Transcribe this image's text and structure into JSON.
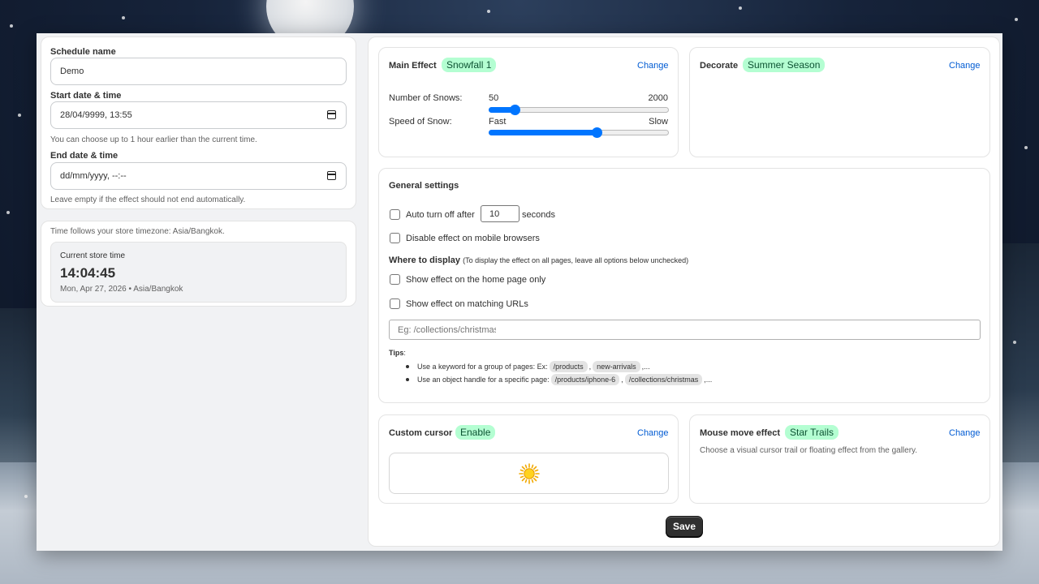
{
  "schedule": {
    "name_label": "Schedule name",
    "name_value": "Demo",
    "start_label": "Start date & time",
    "start_value": "28/04/9999, 13:55",
    "start_help": "You can choose up to 1 hour earlier than the current time.",
    "end_label": "End date & time",
    "end_placeholder": "dd/mm/yyyy, --:--",
    "end_help": "Leave empty if the effect should not end automatically."
  },
  "timezone": {
    "note": "Time follows your store timezone: Asia/Bangkok.",
    "current_label": "Current store time",
    "time": "14:04:45",
    "date_line": "Mon, Apr 27, 2026 • Asia/Bangkok"
  },
  "main_effect": {
    "label": "Main Effect",
    "badge": "Snowfall 1",
    "change": "Change",
    "snows_label": "Number of Snows:",
    "snows_min": "50",
    "snows_max": "2000",
    "snows_value_fraction": 0.14,
    "speed_label": "Speed of Snow:",
    "speed_min": "Fast",
    "speed_max": "Slow",
    "speed_value_fraction": 0.6
  },
  "decorate": {
    "label": "Decorate",
    "badge": "Summer Season",
    "change": "Change"
  },
  "general": {
    "title": "General settings",
    "auto_off_prefix": "Auto turn off after",
    "auto_off_value": "10",
    "auto_off_suffix": "seconds",
    "disable_mobile": "Disable effect on mobile browsers",
    "where_title": "Where to display",
    "where_note": "(To display the effect on all pages, leave all options below unchecked)",
    "home_only": "Show effect on the home page only",
    "matching_urls": "Show effect on matching URLs",
    "url_placeholder": "Eg: /collections/christmas",
    "tips_label": "Tips",
    "tip1_text": "Use a keyword for a group of pages: Ex:",
    "tip1_chip1": "/products",
    "tip1_chip2": "new-arrivals",
    "tip2_text": "Use an object handle for a specific page:",
    "tip2_chip1": "/products/iphone-6",
    "tip2_chip2": "/collections/christmas",
    "sep_comma": ",",
    "trailing": ",..."
  },
  "cursor": {
    "label": "Custom cursor",
    "badge": "Enable",
    "change": "Change",
    "preview_icon": "sun-icon"
  },
  "mouse_move": {
    "label": "Mouse move effect",
    "badge": "Star Trails",
    "change": "Change",
    "description": "Choose a visual cursor trail or floating effect from the gallery."
  },
  "actions": {
    "save": "Save"
  },
  "colors": {
    "accent": "#005bd3",
    "badge_bg": "#b4fed2",
    "slider": "#0075ff"
  }
}
